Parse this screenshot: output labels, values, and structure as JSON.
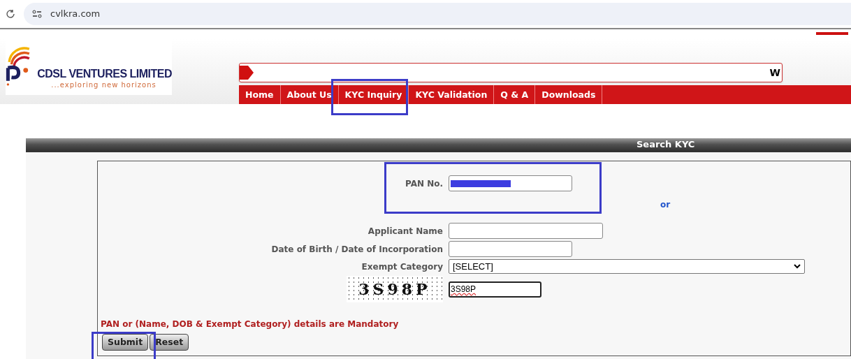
{
  "browser": {
    "url": "cvlkra.com"
  },
  "brand": {
    "name": "CDSL VENTURES LIMITED",
    "tagline": "...exploring new horizons"
  },
  "ticker": {
    "text": "W"
  },
  "nav": [
    {
      "label": "Home"
    },
    {
      "label": "About Us"
    },
    {
      "label": "KYC Inquiry"
    },
    {
      "label": "KYC Validation"
    },
    {
      "label": "Q & A"
    },
    {
      "label": "Downloads"
    }
  ],
  "panel": {
    "title": "Search KYC"
  },
  "form": {
    "pan_label": "PAN No.",
    "pan_redacted": true,
    "or": "or",
    "fields": [
      {
        "kind": "long",
        "label": "Applicant Name"
      },
      {
        "kind": "short",
        "label": "Date of Birth / Date of Incorporation"
      },
      {
        "kind": "select",
        "label": "Exempt Category",
        "value": "[SELECT]"
      }
    ],
    "captcha": {
      "image_text": "3S98P",
      "value": "3S98P"
    },
    "notice": "PAN or (Name, DOB & Exempt Category) details are Mandatory",
    "buttons": [
      "Submit",
      "Reset"
    ]
  }
}
